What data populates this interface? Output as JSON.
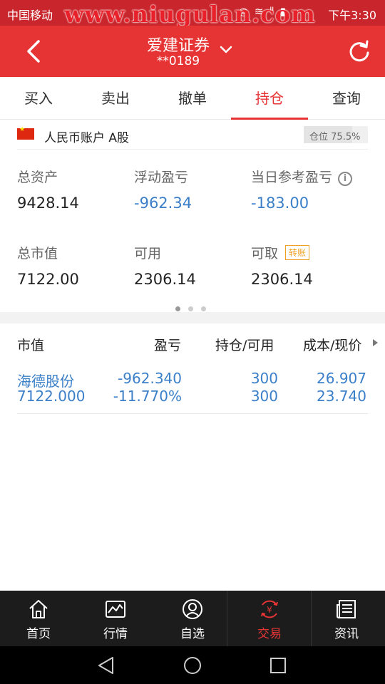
{
  "status_bar": {
    "carrier": "中国移动",
    "icons": "◎ ≋ ᐦ ▮",
    "time": "下午3:30"
  },
  "watermark": "www.niugulan.com",
  "app_bar": {
    "title": "爱建证券",
    "account_suffix": "**0189"
  },
  "tabs": [
    {
      "label": "买入",
      "active": false
    },
    {
      "label": "卖出",
      "active": false
    },
    {
      "label": "撤单",
      "active": false
    },
    {
      "label": "持仓",
      "active": true
    },
    {
      "label": "查询",
      "active": false
    }
  ],
  "account": {
    "name": "人民币账户 A股",
    "position_label": "仓位",
    "position_value": "75.5%",
    "position_ratio": 0.755
  },
  "summary": {
    "total_assets_label": "总资产",
    "total_assets": "9428.14",
    "floating_pl_label": "浮动盈亏",
    "floating_pl": "-962.34",
    "daily_pl_label": "当日参考盈亏",
    "daily_pl": "-183.00",
    "market_value_label": "总市值",
    "market_value": "7122.00",
    "available_label": "可用",
    "available": "2306.14",
    "withdrawable_label": "可取",
    "transfer_badge": "转账",
    "withdrawable": "2306.14"
  },
  "pager": {
    "pages": 3,
    "current": 0
  },
  "holdings_header": {
    "col1": "市值",
    "col2": "盈亏",
    "col3": "持仓/可用",
    "col4": "成本/现价"
  },
  "holdings": [
    {
      "name": "海德股份",
      "market_value": "7122.000",
      "pl": "-962.340",
      "pl_pct": "-11.770%",
      "holding": "300",
      "available": "300",
      "cost": "26.907",
      "price": "23.740"
    }
  ],
  "bottom_nav": [
    {
      "label": "首页",
      "icon": "home-icon",
      "active": false
    },
    {
      "label": "行情",
      "icon": "chart-icon",
      "active": false
    },
    {
      "label": "自选",
      "icon": "user-circle-icon",
      "active": false
    },
    {
      "label": "交易",
      "icon": "yuan-exchange-icon",
      "active": true
    },
    {
      "label": "资讯",
      "icon": "news-icon",
      "active": false
    }
  ],
  "colors": {
    "brand_red": "#e63435",
    "status_red": "#c8262c",
    "value_blue": "#3a7fc8",
    "badge_orange": "#f0a020"
  }
}
